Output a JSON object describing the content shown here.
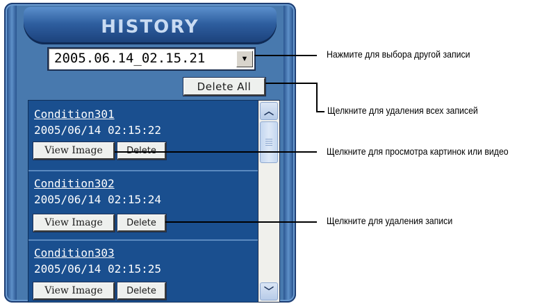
{
  "panel": {
    "title": "HISTORY",
    "dropdown": {
      "selected": "2005.06.14_02.15.21",
      "arrow_icon": "chevron-down-icon"
    },
    "delete_all_label": "Delete All",
    "records": [
      {
        "name": "Condition301",
        "timestamp": "2005/06/14 02:15:22",
        "view_label": "View Image",
        "delete_label": "Delete"
      },
      {
        "name": "Condition302",
        "timestamp": "2005/06/14 02:15:24",
        "view_label": "View Image",
        "delete_label": "Delete"
      },
      {
        "name": "Condition303",
        "timestamp": "2005/06/14 02:15:25",
        "view_label": "View Image",
        "delete_label": "Delete"
      }
    ]
  },
  "callouts": {
    "select_record": "Нажмите для выбора другой записи",
    "delete_all": "Щелкните для удаления всех записей",
    "view_image": "Щелкните для просмотра картинок или видео",
    "delete_record": "Щелкните для удаления записи"
  },
  "colors": {
    "panel": "#4879ae",
    "list": "#1a4f8f",
    "title_text": "#c9dbf2"
  }
}
